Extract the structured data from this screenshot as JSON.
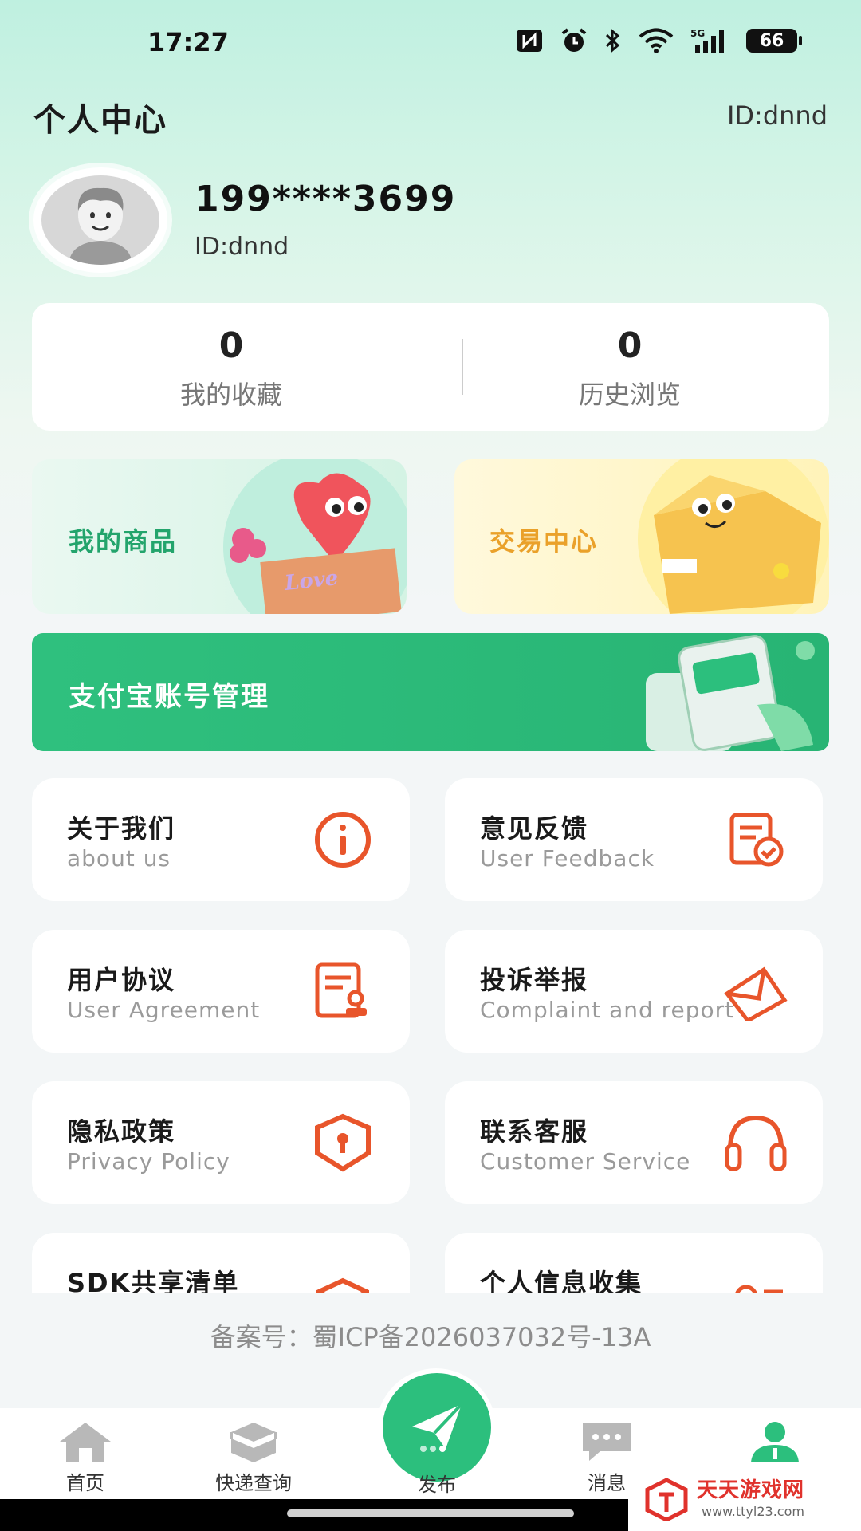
{
  "status_bar": {
    "time": "17:27",
    "battery": "66"
  },
  "header": {
    "title": "个人中心",
    "id_label": "ID:dnnd"
  },
  "profile": {
    "phone": "199****3699",
    "id": "ID:dnnd"
  },
  "stats": [
    {
      "value": "0",
      "label": "我的收藏"
    },
    {
      "value": "0",
      "label": "历史浏览"
    }
  ],
  "promos": {
    "goods": "我的商品",
    "trade": "交易中心"
  },
  "alipay": {
    "label": "支付宝账号管理"
  },
  "menu": [
    {
      "title": "关于我们",
      "subtitle": "about us",
      "icon": "info-icon"
    },
    {
      "title": "意见反馈",
      "subtitle": "User Feedback",
      "icon": "feedback-icon"
    },
    {
      "title": "用户协议",
      "subtitle": "User Agreement",
      "icon": "agreement-icon"
    },
    {
      "title": "投诉举报",
      "subtitle": "Complaint and report",
      "icon": "envelope-icon"
    },
    {
      "title": "隐私政策",
      "subtitle": "Privacy Policy",
      "icon": "shield-icon"
    },
    {
      "title": "联系客服",
      "subtitle": "Customer Service",
      "icon": "headset-icon"
    },
    {
      "title": "SDK共享清单",
      "subtitle": "",
      "icon": "box-icon"
    },
    {
      "title": "个人信息收集",
      "subtitle": "",
      "icon": "user-list-icon"
    }
  ],
  "icp": "备案号：蜀ICP备2026037032号-13A",
  "tabs": [
    {
      "label": "首页",
      "icon": "home-icon"
    },
    {
      "label": "快递查询",
      "icon": "parcel-icon"
    },
    {
      "label": "发布",
      "icon": "paper-plane-icon"
    },
    {
      "label": "消息",
      "icon": "message-icon"
    },
    {
      "label": "",
      "icon": "profile-icon"
    }
  ],
  "watermark": {
    "text": "天天游戏网",
    "url": "www.ttyl23.com"
  },
  "colors": {
    "accent": "#2cbf7d",
    "icon_orange": "#e8552b",
    "trade_yellow": "#eaa12a"
  }
}
